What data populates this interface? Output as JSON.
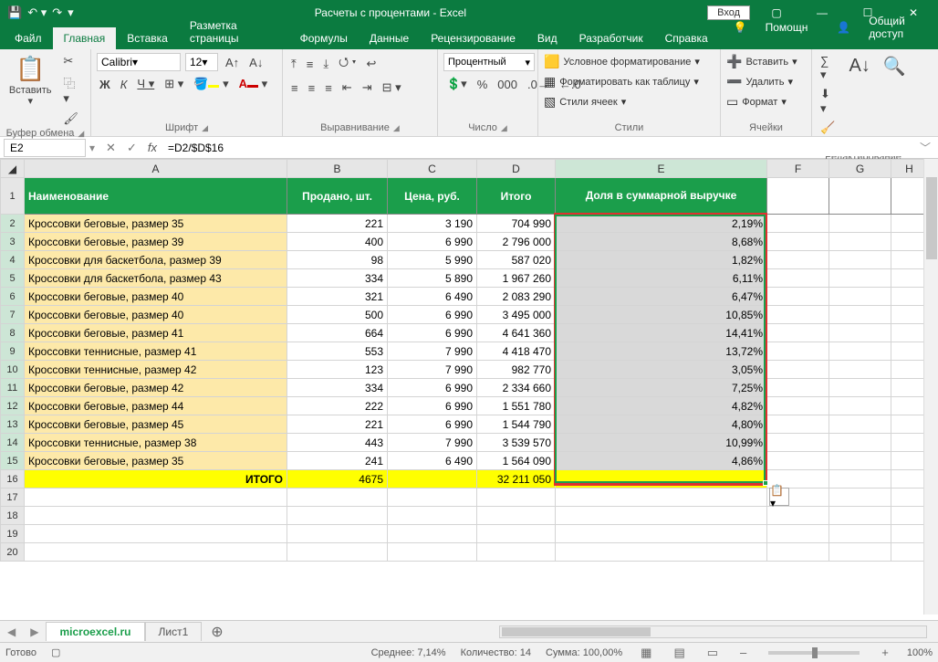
{
  "titlebar": {
    "title": "Расчеты с процентами  -  Excel",
    "login": "Вход"
  },
  "tabs": {
    "file": "Файл",
    "home": "Главная",
    "insert": "Вставка",
    "page_layout": "Разметка страницы",
    "formulas": "Формулы",
    "data": "Данные",
    "review": "Рецензирование",
    "view": "Вид",
    "developer": "Разработчик",
    "help": "Справка",
    "tell_me": "Помощн",
    "share": "Общий доступ"
  },
  "ribbon": {
    "clipboard": {
      "paste": "Вставить",
      "label": "Буфер обмена"
    },
    "font": {
      "name": "Calibri",
      "size": "12",
      "label": "Шрифт"
    },
    "alignment": {
      "label": "Выравнивание"
    },
    "number": {
      "format": "Процентный",
      "label": "Число"
    },
    "styles": {
      "cond_fmt": "Условное форматирование",
      "table_fmt": "Форматировать как таблицу",
      "cell_styles": "Стили ячеек",
      "label": "Стили"
    },
    "cells": {
      "insert": "Вставить",
      "delete": "Удалить",
      "format": "Формат",
      "label": "Ячейки"
    },
    "editing": {
      "label": "Редактирование"
    }
  },
  "fbar": {
    "namebox": "E2",
    "formula": "=D2/$D$16"
  },
  "cols": {
    "A": "A",
    "B": "B",
    "C": "C",
    "D": "D",
    "E": "E",
    "F": "F",
    "G": "G",
    "H": "H"
  },
  "header": {
    "name": "Наименование",
    "qty": "Продано, шт.",
    "price": "Цена, руб.",
    "total": "Итого",
    "share": "Доля в суммарной выручке"
  },
  "rows": [
    {
      "n": "2",
      "name": "Кроссовки беговые, размер 35",
      "qty": "221",
      "price": "3 190",
      "total": "704 990",
      "share": "2,19%"
    },
    {
      "n": "3",
      "name": "Кроссовки беговые, размер 39",
      "qty": "400",
      "price": "6 990",
      "total": "2 796 000",
      "share": "8,68%"
    },
    {
      "n": "4",
      "name": "Кроссовки для баскетбола, размер 39",
      "qty": "98",
      "price": "5 990",
      "total": "587 020",
      "share": "1,82%"
    },
    {
      "n": "5",
      "name": "Кроссовки для баскетбола, размер 43",
      "qty": "334",
      "price": "5 890",
      "total": "1 967 260",
      "share": "6,11%"
    },
    {
      "n": "6",
      "name": "Кроссовки беговые, размер 40",
      "qty": "321",
      "price": "6 490",
      "total": "2 083 290",
      "share": "6,47%"
    },
    {
      "n": "7",
      "name": "Кроссовки беговые, размер 40",
      "qty": "500",
      "price": "6 990",
      "total": "3 495 000",
      "share": "10,85%"
    },
    {
      "n": "8",
      "name": "Кроссовки беговые, размер 41",
      "qty": "664",
      "price": "6 990",
      "total": "4 641 360",
      "share": "14,41%"
    },
    {
      "n": "9",
      "name": "Кроссовки теннисные, размер 41",
      "qty": "553",
      "price": "7 990",
      "total": "4 418 470",
      "share": "13,72%"
    },
    {
      "n": "10",
      "name": "Кроссовки теннисные, размер 42",
      "qty": "123",
      "price": "7 990",
      "total": "982 770",
      "share": "3,05%"
    },
    {
      "n": "11",
      "name": "Кроссовки беговые, размер 42",
      "qty": "334",
      "price": "6 990",
      "total": "2 334 660",
      "share": "7,25%"
    },
    {
      "n": "12",
      "name": "Кроссовки беговые, размер 44",
      "qty": "222",
      "price": "6 990",
      "total": "1 551 780",
      "share": "4,82%"
    },
    {
      "n": "13",
      "name": "Кроссовки беговые, размер 45",
      "qty": "221",
      "price": "6 990",
      "total": "1 544 790",
      "share": "4,80%"
    },
    {
      "n": "14",
      "name": "Кроссовки теннисные, размер 38",
      "qty": "443",
      "price": "7 990",
      "total": "3 539 570",
      "share": "10,99%"
    },
    {
      "n": "15",
      "name": "Кроссовки беговые, размер 35",
      "qty": "241",
      "price": "6 490",
      "total": "1 564 090",
      "share": "4,86%"
    }
  ],
  "total_row": {
    "n": "16",
    "label": "ИТОГО",
    "qty": "4675",
    "total": "32 211 050"
  },
  "empty_rows": [
    "17",
    "18",
    "19",
    "20"
  ],
  "sheet_tabs": {
    "s1": "microexcel.ru",
    "s2": "Лист1"
  },
  "status": {
    "ready": "Готово",
    "avg_lbl": "Среднее:",
    "avg_val": "7,14%",
    "count_lbl": "Количество:",
    "count_val": "14",
    "sum_lbl": "Сумма:",
    "sum_val": "100,00%",
    "zoom": "100%"
  }
}
